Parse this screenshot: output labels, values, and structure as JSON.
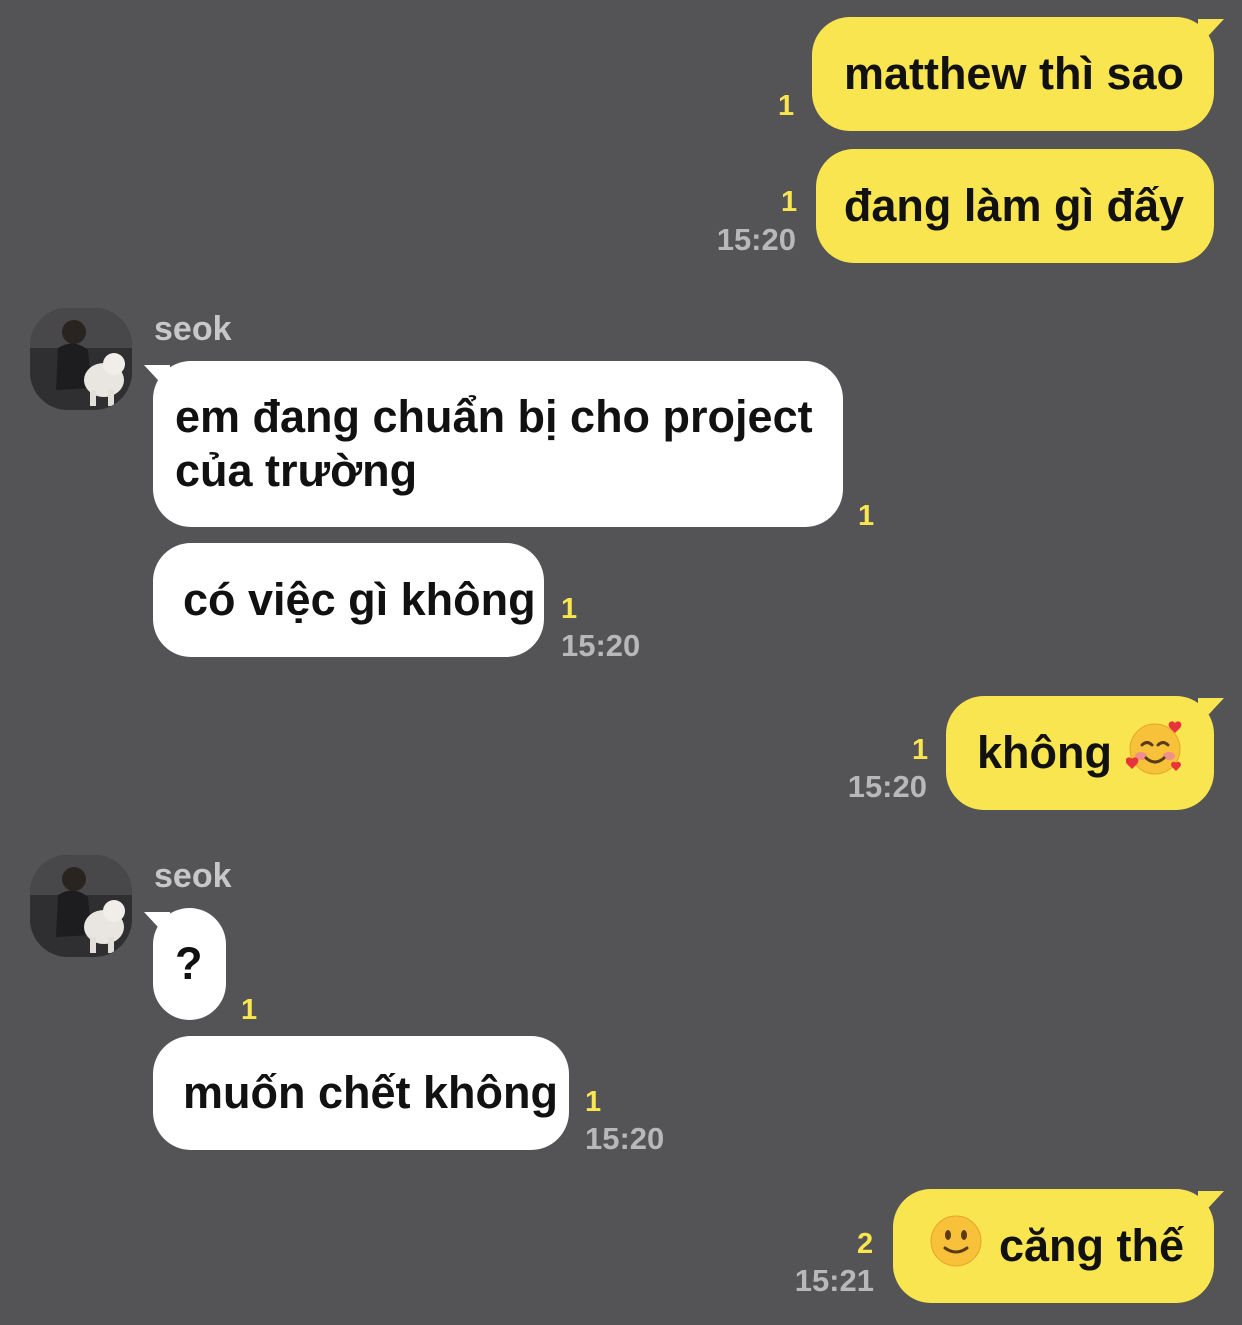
{
  "messages": [
    {
      "id": "m1",
      "side": "me",
      "text": "matthew thì sao",
      "unread": "1"
    },
    {
      "id": "m2",
      "side": "me",
      "text": "đang làm gì đấy",
      "unread": "1",
      "time": "15:20"
    },
    {
      "id": "m3",
      "side": "them",
      "sender": "seok",
      "text": "em đang chuẩn bị cho project của trường",
      "unread": "1"
    },
    {
      "id": "m4",
      "side": "them",
      "text": "có việc gì không",
      "unread": "1",
      "time": "15:20"
    },
    {
      "id": "m5",
      "side": "me",
      "text": "không",
      "emoji": "smiling-face-with-hearts",
      "unread": "1",
      "time": "15:20"
    },
    {
      "id": "m6",
      "side": "them",
      "sender": "seok",
      "text": "?",
      "unread": "1"
    },
    {
      "id": "m7",
      "side": "them",
      "text": "muốn chết không",
      "unread": "1",
      "time": "15:20"
    },
    {
      "id": "m8",
      "side": "me",
      "emoji": "slightly-smiling-face",
      "text": "căng thế",
      "unread": "2",
      "time": "15:21"
    }
  ],
  "colors": {
    "background": "#545355",
    "my_bubble": "#f9e54f",
    "their_bubble": "#ffffff",
    "unread_count": "#f9e54f",
    "timestamp": "#b8b7ba",
    "sender_name": "#c7c6c9"
  }
}
